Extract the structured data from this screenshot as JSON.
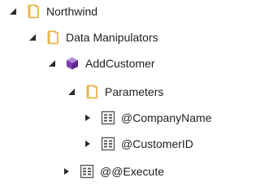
{
  "tree": {
    "nodes": [
      {
        "label": "Northwind",
        "icon": "folder-icon",
        "state": "expanded"
      },
      {
        "label": "Data Manipulators",
        "icon": "folder-icon",
        "state": "expanded"
      },
      {
        "label": "AddCustomer",
        "icon": "cube-icon",
        "state": "expanded"
      },
      {
        "label": "Parameters",
        "icon": "folder-icon",
        "state": "expanded"
      },
      {
        "label": "@CompanyName",
        "icon": "parameter-icon",
        "state": "collapsed"
      },
      {
        "label": "@CustomerID",
        "icon": "parameter-icon",
        "state": "collapsed"
      },
      {
        "label": "@@Execute",
        "icon": "parameter-icon",
        "state": "collapsed"
      }
    ]
  },
  "colors": {
    "folder": "#e8b64b",
    "cube_top": "#b88ad8",
    "cube_left": "#7a3bb0",
    "cube_right": "#5b2790",
    "arrow": "#2b2b2b",
    "param_icon": "#5a5a5a"
  }
}
